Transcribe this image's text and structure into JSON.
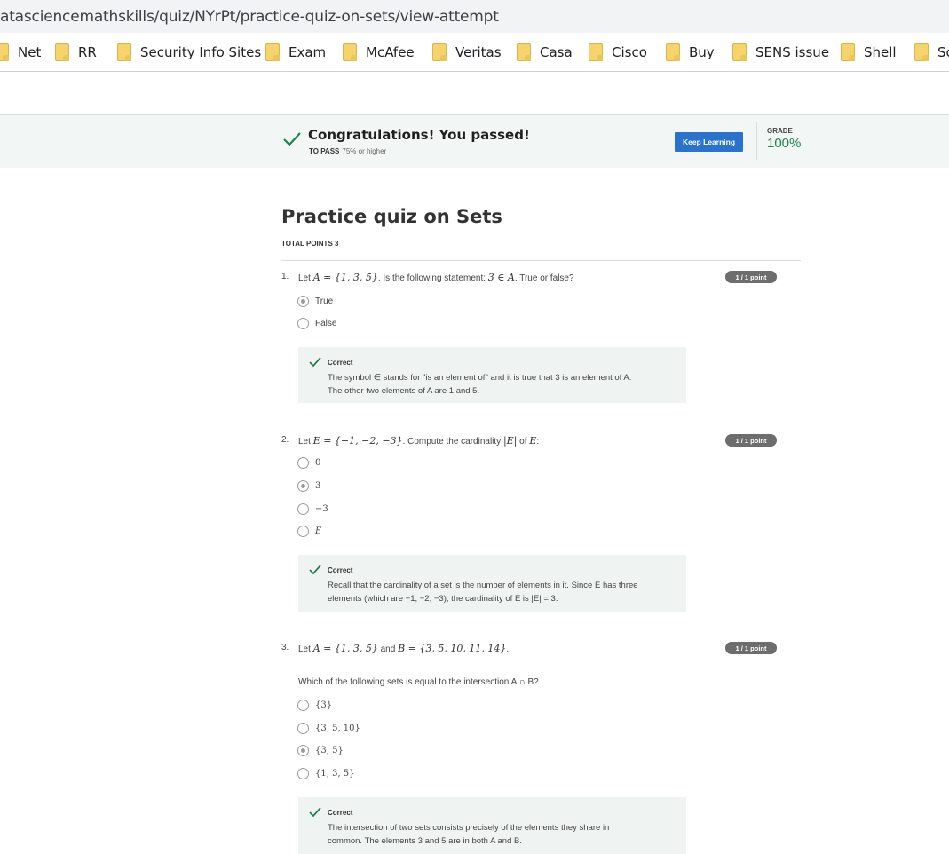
{
  "browser": {
    "url": "atasciencemathskills/quiz/NYrPt/practice-quiz-on-sets/view-attempt",
    "bookmarks": [
      "Net",
      "RR",
      "Security Info Sites",
      "Exam",
      "McAfee",
      "Veritas",
      "Casa",
      "Cisco",
      "Buy",
      "SENS issue",
      "Shell",
      "Sc"
    ]
  },
  "banner": {
    "message": "Congratulations! You passed!",
    "to_pass_label": "TO PASS",
    "to_pass_value": "75% or higher",
    "button_label": "Keep Learning",
    "grade_label": "GRADE",
    "grade_value": "100%",
    "accent_color": "#1f8354",
    "button_color": "#2a73cc"
  },
  "quiz": {
    "title": "Practice quiz on Sets",
    "total_points": "TOTAL POINTS 3",
    "questions": [
      {
        "number": "1.",
        "text_parts": [
          "Let ",
          "A = {1, 3, 5}",
          ". Is the following statement: ",
          "3 ∈ A",
          ". True or false?"
        ],
        "points": "1 / 1 point",
        "options": [
          "True",
          "False"
        ],
        "selected_index": 0,
        "feedback_label": "Correct",
        "feedback_line1": "The symbol ∈ stands for \"is an element of\" and it is true that 3 is an element of A.",
        "feedback_line2": "The other two elements of A are 1 and 5."
      },
      {
        "number": "2.",
        "text_parts": [
          "Let ",
          "E = {−1, −2, −3}",
          ". Compute the cardinality ",
          "|E|",
          " of ",
          "E",
          ":"
        ],
        "points": "1 / 1 point",
        "options": [
          "0",
          "3",
          "−3",
          "E"
        ],
        "selected_index": 1,
        "feedback_label": "Correct",
        "feedback_line1": "Recall that the cardinality of a set is the number of elements in it. Since E has three",
        "feedback_line2": "elements (which are −1, −2, −3), the cardinality of E is |E| = 3."
      },
      {
        "number": "3.",
        "text_parts": [
          "Let ",
          "A = {1, 3, 5}",
          " and ",
          "B = {3, 5, 10, 11, 14}",
          "."
        ],
        "sub_question": "Which of the following sets is equal to the intersection A ∩ B?",
        "points": "1 / 1 point",
        "options": [
          "{3}",
          "{3, 5, 10}",
          "{3, 5}",
          "{1, 3, 5}"
        ],
        "selected_index": 2,
        "feedback_label": "Correct",
        "feedback_line1": "The intersection of two sets consists precisely of the elements they share in",
        "feedback_line2": "common. The elements 3 and 5 are in both A and B."
      }
    ]
  }
}
